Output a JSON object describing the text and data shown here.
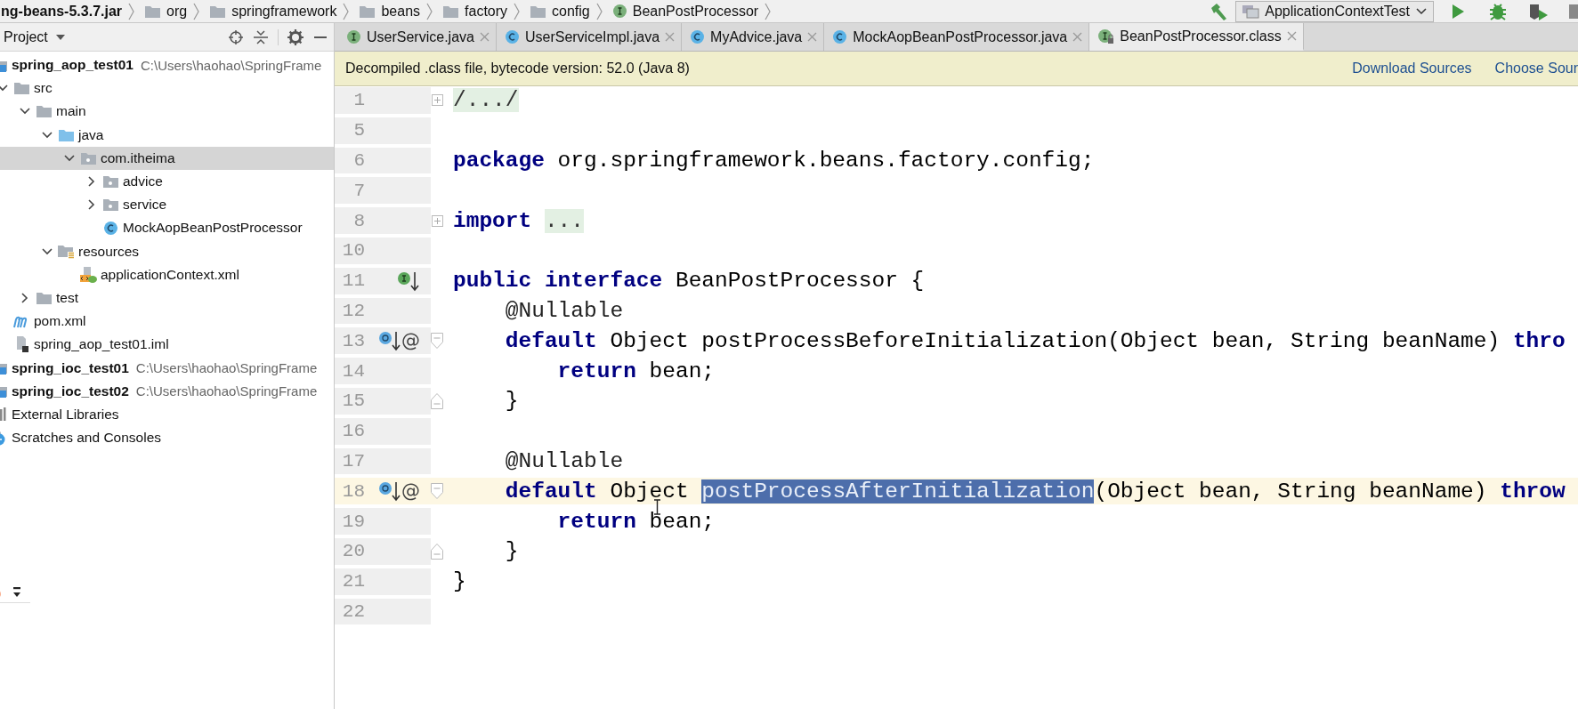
{
  "breadcrumbs": [
    {
      "label": "ng-beans-5.3.7.jar",
      "kind": "jar"
    },
    {
      "label": "org",
      "kind": "folder"
    },
    {
      "label": "springframework",
      "kind": "folder"
    },
    {
      "label": "beans",
      "kind": "folder"
    },
    {
      "label": "factory",
      "kind": "folder"
    },
    {
      "label": "config",
      "kind": "folder"
    },
    {
      "label": "BeanPostProcessor",
      "kind": "interface"
    }
  ],
  "run_toolbar": {
    "configuration": "ApplicationContextTest"
  },
  "project_panel": {
    "title": "Project",
    "tree": [
      {
        "label": "spring_aop_test01",
        "kind": "module",
        "path": "C:\\Users\\haohao\\SpringFrame",
        "selected": false,
        "children": [
          {
            "label": "src",
            "kind": "folder",
            "expanded": true,
            "selected": false,
            "children": [
              {
                "label": "main",
                "kind": "folder",
                "expanded": true,
                "selected": false,
                "children": [
                  {
                    "label": "java",
                    "kind": "source-folder",
                    "expanded": true,
                    "selected": false,
                    "children": [
                      {
                        "label": "com.itheima",
                        "kind": "package",
                        "expanded": true,
                        "selected": true,
                        "children": [
                          {
                            "label": "advice",
                            "kind": "package",
                            "expanded": false,
                            "selected": false
                          },
                          {
                            "label": "service",
                            "kind": "package",
                            "expanded": false,
                            "selected": false
                          },
                          {
                            "label": "MockAopBeanPostProcessor",
                            "kind": "class",
                            "selected": false
                          }
                        ]
                      }
                    ]
                  },
                  {
                    "label": "resources",
                    "kind": "resources-folder",
                    "expanded": true,
                    "selected": false,
                    "children": [
                      {
                        "label": "applicationContext.xml",
                        "kind": "xml",
                        "selected": false
                      }
                    ]
                  }
                ]
              },
              {
                "label": "test",
                "kind": "folder",
                "expanded": false,
                "selected": false
              }
            ]
          },
          {
            "label": "pom.xml",
            "kind": "maven",
            "selected": false
          },
          {
            "label": "spring_aop_test01.iml",
            "kind": "iml",
            "selected": false
          }
        ]
      },
      {
        "label": "spring_ioc_test01",
        "kind": "module",
        "path": "C:\\Users\\haohao\\SpringFrame",
        "selected": false
      },
      {
        "label": "spring_ioc_test02",
        "kind": "module",
        "path": "C:\\Users\\haohao\\SpringFrame",
        "selected": false
      },
      {
        "label": "External Libraries",
        "kind": "libraries",
        "selected": false
      },
      {
        "label": "Scratches and Consoles",
        "kind": "scratches",
        "selected": false
      }
    ]
  },
  "editor": {
    "tabs": [
      {
        "label": "UserService.java",
        "kind": "interface",
        "selected": false
      },
      {
        "label": "UserServiceImpl.java",
        "kind": "class",
        "selected": false
      },
      {
        "label": "MyAdvice.java",
        "kind": "class",
        "selected": false
      },
      {
        "label": "MockAopBeanPostProcessor.java",
        "kind": "class",
        "selected": false
      },
      {
        "label": "BeanPostProcessor.class",
        "kind": "compiled-interface",
        "selected": true
      }
    ],
    "banner": {
      "message": "Decompiled .class file, bytecode version: 52.0 (Java 8)",
      "actions": [
        "Download Sources",
        "Choose Sour"
      ]
    },
    "lines": [
      {
        "number": "1",
        "fold": {
          "kind": "expand"
        },
        "current": false,
        "tokens": [
          {
            "text": "/.../",
            "kind": "folded"
          }
        ]
      },
      {
        "number": "5",
        "current": false
      },
      {
        "number": "6",
        "current": false,
        "tokens": [
          {
            "text": "package",
            "kind": "keyword"
          },
          {
            "text": " org.springframework.beans.factory.config;",
            "kind": "plain"
          }
        ]
      },
      {
        "number": "7",
        "current": false
      },
      {
        "number": "8",
        "fold": {
          "kind": "expand"
        },
        "current": false,
        "tokens": [
          {
            "text": "import ",
            "kind": "keyword"
          },
          {
            "text": "...",
            "kind": "folded"
          }
        ]
      },
      {
        "number": "10",
        "current": false
      },
      {
        "number": "11",
        "current": false,
        "gutter": [
          {
            "kind": "implemented"
          }
        ],
        "tokens": [
          {
            "text": "public interface",
            "kind": "keyword"
          },
          {
            "text": " BeanPostProcessor {",
            "kind": "plain"
          }
        ]
      },
      {
        "number": "12",
        "current": false,
        "tokens": [
          {
            "text": "    @Nullable",
            "kind": "annotation"
          }
        ]
      },
      {
        "number": "13",
        "fold": {
          "kind": "start"
        },
        "current": false,
        "gutter": [
          {
            "kind": "overriding"
          },
          {
            "kind": "annotation",
            "text": "@"
          }
        ],
        "tokens": [
          {
            "text": "    default",
            "kind": "keyword"
          },
          {
            "text": " Object postProcessBeforeInitialization(Object bean, String beanName) ",
            "kind": "plain"
          },
          {
            "text": "thro",
            "kind": "keyword"
          }
        ]
      },
      {
        "number": "14",
        "current": false,
        "tokens": [
          {
            "text": "        return",
            "kind": "keyword"
          },
          {
            "text": " bean;",
            "kind": "plain"
          }
        ]
      },
      {
        "number": "15",
        "fold": {
          "kind": "end"
        },
        "current": false,
        "tokens": [
          {
            "text": "    }",
            "kind": "plain"
          }
        ]
      },
      {
        "number": "16",
        "current": false
      },
      {
        "number": "17",
        "current": false,
        "tokens": [
          {
            "text": "    @Nullable",
            "kind": "annotation"
          }
        ]
      },
      {
        "number": "18",
        "fold": {
          "kind": "start"
        },
        "current": true,
        "gutter": [
          {
            "kind": "overriding"
          },
          {
            "kind": "annotation",
            "text": "@"
          }
        ],
        "tokens": [
          {
            "text": "    default",
            "kind": "keyword"
          },
          {
            "text": " Object ",
            "kind": "plain"
          },
          {
            "text": "postProcessAfterInitialization",
            "kind": "selected"
          },
          {
            "text": "(Object bean, String beanName) ",
            "kind": "plain"
          },
          {
            "text": "throw",
            "kind": "keyword"
          }
        ]
      },
      {
        "number": "19",
        "current": false,
        "tokens": [
          {
            "text": "        return",
            "kind": "keyword"
          },
          {
            "text": " bean;",
            "kind": "plain"
          }
        ]
      },
      {
        "number": "20",
        "fold": {
          "kind": "end"
        },
        "current": false,
        "tokens": [
          {
            "text": "    }",
            "kind": "plain"
          }
        ]
      },
      {
        "number": "21",
        "current": false,
        "tokens": [
          {
            "text": "}",
            "kind": "plain"
          }
        ]
      },
      {
        "number": "22",
        "current": false
      }
    ]
  }
}
